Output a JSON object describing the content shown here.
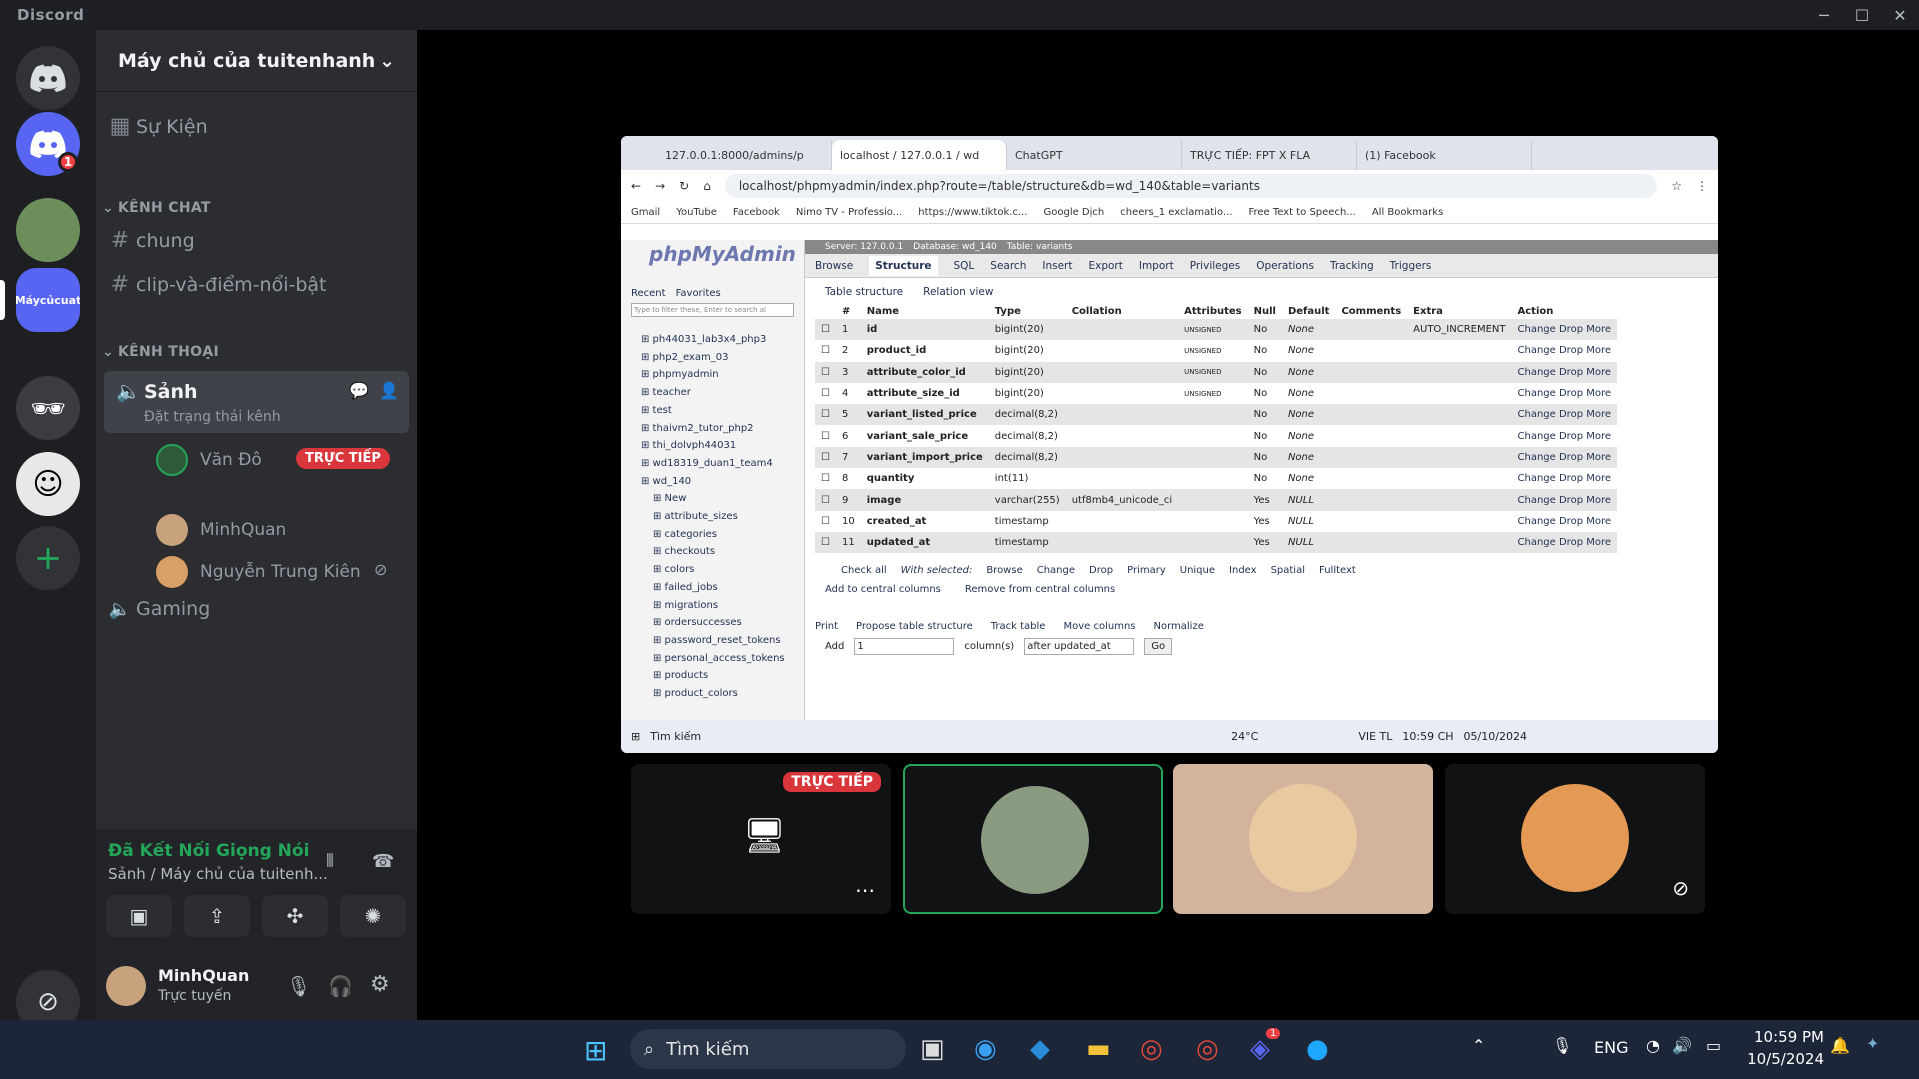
{
  "app": {
    "brand": "Discord"
  },
  "window_controls": {
    "min": "─",
    "max": "☐",
    "close": "✕"
  },
  "servers": [
    {
      "name": "Máycủcuat"
    }
  ],
  "badges": {
    "home": "1"
  },
  "server": {
    "name": "Máy chủ của tuitenhanh"
  },
  "events": {
    "label": "Sự Kiện"
  },
  "categories": {
    "chat": "KÊNH CHAT",
    "voice": "KÊNH THOẠI"
  },
  "text_channels": [
    {
      "label": "chung"
    },
    {
      "label": "clip-và-điểm-nổi-bật"
    }
  ],
  "voice_channels": [
    {
      "label": "Sảnh",
      "status": "Đặt trạng thái kênh"
    },
    {
      "label": "Gaming"
    }
  ],
  "voice_users": [
    {
      "name": "Văn Đô",
      "live": "TRỰC TIẾP"
    },
    {
      "name": "MinhQuan"
    },
    {
      "name": "Nguyễn Trung Kiên"
    }
  ],
  "voice_panel": {
    "status": "Đã Kết Nối Giọng Nói",
    "location": "Sảnh / Máy chủ của tuitenh..."
  },
  "user": {
    "name": "MinhQuan",
    "status": "Trực tuyến"
  },
  "browser": {
    "tabs": [
      "127.0.0.1:8000/admins/p",
      "localhost / 127.0.0.1 / wd",
      "ChatGPT",
      "TRỰC TIẾP: FPT X FLA",
      "(1) Facebook"
    ],
    "url": "localhost/phpmyadmin/index.php?route=/table/structure&db=wd_140&table=variants",
    "bookmarks": [
      "Gmail",
      "YouTube",
      "Facebook",
      "Nimo TV - Professio...",
      "https://www.tiktok.c...",
      "Google Dịch",
      "cheers_1 exclamatio...",
      "Free Text to Speech...",
      "All Bookmarks"
    ]
  },
  "pma": {
    "logo": "phpMyAdmin",
    "left_tabs": [
      "Recent",
      "Favorites"
    ],
    "filter": "Type to filter these, Enter to search al",
    "databases": [
      "ph44031_lab3x4_php3",
      "php2_exam_03",
      "phpmyadmin",
      "teacher",
      "test",
      "thaivm2_tutor_php2",
      "thi_dolvph44031",
      "wd18319_duan1_team4",
      "wd_140",
      "New",
      "attribute_sizes",
      "categories",
      "checkouts",
      "colors",
      "failed_jobs",
      "migrations",
      "ordersuccesses",
      "password_reset_tokens",
      "personal_access_tokens",
      "products",
      "product_colors"
    ],
    "breadcrumb": [
      "Server: 127.0.0.1",
      "Database: wd_140",
      "Table: variants"
    ],
    "tabs": [
      "Browse",
      "Structure",
      "SQL",
      "Search",
      "Insert",
      "Export",
      "Import",
      "Privileges",
      "Operations",
      "Tracking",
      "Triggers"
    ],
    "subtabs": [
      "Table structure",
      "Relation view"
    ],
    "columns": [
      "#",
      "Name",
      "Type",
      "Collation",
      "Attributes",
      "Null",
      "Default",
      "Comments",
      "Extra",
      "Action"
    ],
    "rows": [
      [
        "1",
        "id",
        "bigint(20)",
        "",
        "UNSIGNED",
        "No",
        "None",
        "",
        "AUTO_INCREMENT"
      ],
      [
        "2",
        "product_id",
        "bigint(20)",
        "",
        "UNSIGNED",
        "No",
        "None",
        "",
        ""
      ],
      [
        "3",
        "attribute_color_id",
        "bigint(20)",
        "",
        "UNSIGNED",
        "No",
        "None",
        "",
        ""
      ],
      [
        "4",
        "attribute_size_id",
        "bigint(20)",
        "",
        "UNSIGNED",
        "No",
        "None",
        "",
        ""
      ],
      [
        "5",
        "variant_listed_price",
        "decimal(8,2)",
        "",
        "",
        "No",
        "None",
        "",
        ""
      ],
      [
        "6",
        "variant_sale_price",
        "decimal(8,2)",
        "",
        "",
        "No",
        "None",
        "",
        ""
      ],
      [
        "7",
        "variant_import_price",
        "decimal(8,2)",
        "",
        "",
        "No",
        "None",
        "",
        ""
      ],
      [
        "8",
        "quantity",
        "int(11)",
        "",
        "",
        "No",
        "None",
        "",
        ""
      ],
      [
        "9",
        "image",
        "varchar(255)",
        "utf8mb4_unicode_ci",
        "",
        "Yes",
        "NULL",
        "",
        ""
      ],
      [
        "10",
        "created_at",
        "timestamp",
        "",
        "",
        "Yes",
        "NULL",
        "",
        ""
      ],
      [
        "11",
        "updated_at",
        "timestamp",
        "",
        "",
        "Yes",
        "NULL",
        "",
        ""
      ]
    ],
    "actions": [
      "Change",
      "Drop",
      "More"
    ],
    "with_selected": [
      "Check all",
      "With selected:",
      "Browse",
      "Change",
      "Drop",
      "Primary",
      "Unique",
      "Index",
      "Spatial",
      "Fulltext"
    ],
    "central": [
      "Add to central columns",
      "Remove from central columns"
    ],
    "footer": [
      "Print",
      "Propose table structure",
      "Track table",
      "Move columns",
      "Normalize"
    ],
    "add": {
      "label": "Add",
      "value": "1",
      "unit": "column(s)",
      "position": "after updated_at",
      "go": "Go"
    }
  },
  "inner_taskbar": {
    "search": "Tìm kiếm",
    "temp": "24°C",
    "lang": "VIE TL",
    "time": "10:59 CH",
    "date": "05/10/2024"
  },
  "tiles": {
    "live": "TRỰC TIẾP"
  },
  "taskbar": {
    "search": "Tìm kiếm",
    "lang": "ENG",
    "time": "10:59 PM",
    "date": "10/5/2024",
    "chrome_badge": "1"
  }
}
